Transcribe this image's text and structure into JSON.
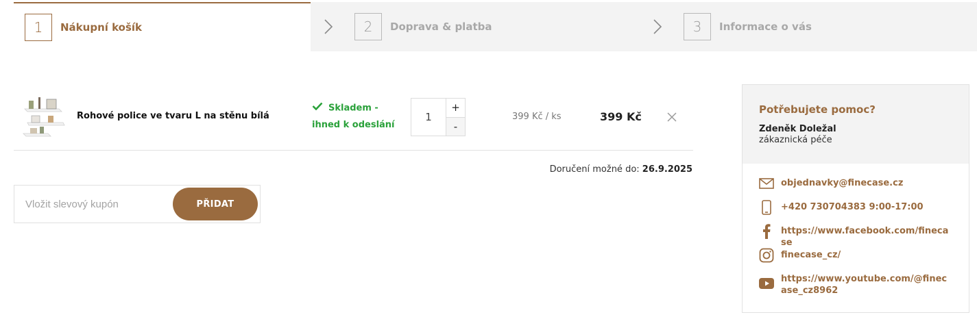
{
  "steps": [
    {
      "number": "1",
      "label": "Nákupní košík"
    },
    {
      "number": "2",
      "label": "Doprava & platba"
    },
    {
      "number": "3",
      "label": "Informace o vás"
    }
  ],
  "cart": {
    "item": {
      "name": "Rohové police ve tvaru L na stěnu bílá",
      "stock": "Skladem - ihned k odeslání",
      "quantity": "1",
      "qty_plus": "+",
      "qty_minus": "-",
      "unit_price": "399 Kč / ks",
      "total_price": "399 Kč"
    },
    "delivery_label": "Doručení možné do:",
    "delivery_date": "26.9.2025"
  },
  "coupon": {
    "placeholder": "Vložit slevový kupón",
    "button_label": "PŘIDAT"
  },
  "help": {
    "title": "Potřebujete pomoc?",
    "name": "Zdeněk Doležal",
    "role": "zákaznická péče",
    "contacts": [
      {
        "icon": "mail-icon",
        "text": "objednavky@finecase.cz"
      },
      {
        "icon": "phone-icon",
        "text": "+420 730704383 9:00-17:00"
      },
      {
        "icon": "facebook-icon",
        "text": "https://www.facebook.com/finecase"
      },
      {
        "icon": "instagram-icon",
        "text": "finecase_cz/"
      },
      {
        "icon": "youtube-icon",
        "text": "https://www.youtube.com/@finecase_cz8962"
      }
    ]
  },
  "colors": {
    "accent": "#9a6b3f",
    "stock_green": "#2aa13a",
    "muted_bg": "#f3f3f3"
  }
}
